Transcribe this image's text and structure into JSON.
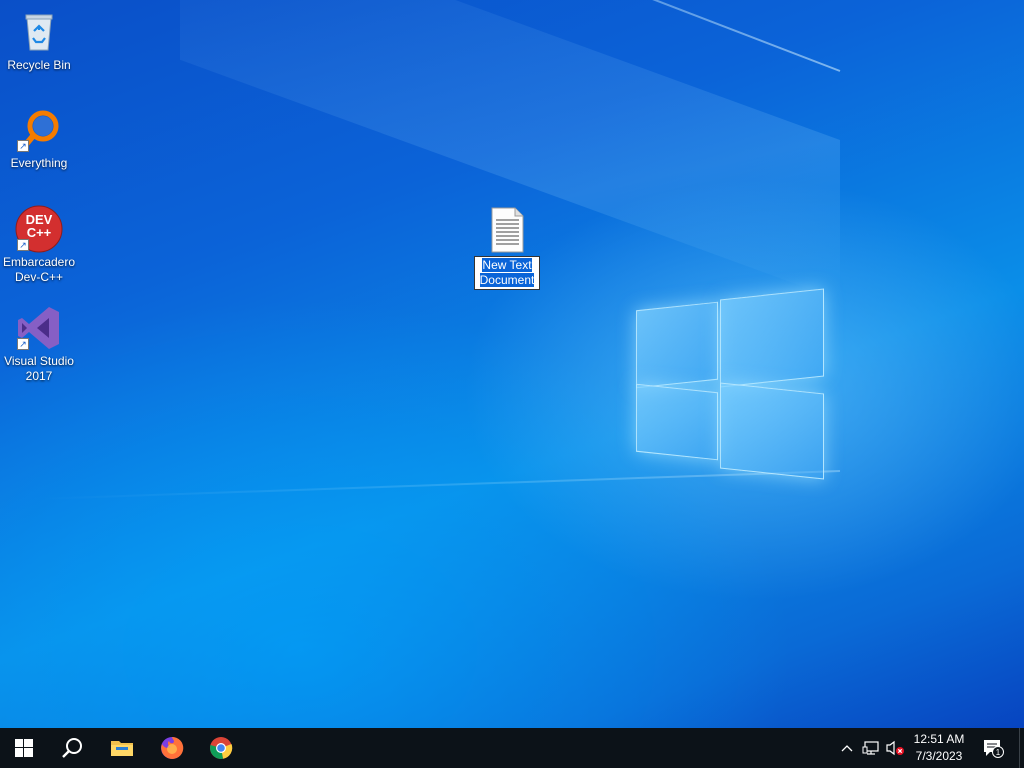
{
  "desktop": {
    "icons": [
      {
        "label": "Recycle Bin",
        "icon": "recycle-bin-icon"
      },
      {
        "label": "Everything",
        "icon": "everything-search-icon"
      },
      {
        "label": "Embarcadero Dev-C++",
        "icon": "dev-cpp-icon",
        "logo_text": "DEV C++"
      },
      {
        "label": "Visual Studio 2017",
        "icon": "visual-studio-icon"
      },
      {
        "label": "New Text Document",
        "icon": "text-document-icon",
        "state": "renaming"
      }
    ]
  },
  "taskbar": {
    "start": "windows-start-icon",
    "search": "search-icon",
    "pinned": [
      {
        "name": "File Explorer",
        "icon": "file-explorer-icon"
      },
      {
        "name": "Firefox",
        "icon": "firefox-icon"
      },
      {
        "name": "Chrome",
        "icon": "chrome-icon"
      }
    ],
    "tray": {
      "overflow": "chevron-up-icon",
      "network": "network-icon",
      "volume": "volume-muted-icon",
      "time": "12:51 AM",
      "date": "7/3/2023",
      "notifications_count": "1"
    }
  },
  "colors": {
    "taskbar_bg": "#0c1218",
    "wallpaper_main": "#0a7ae0",
    "selection": "#0a64d8"
  }
}
